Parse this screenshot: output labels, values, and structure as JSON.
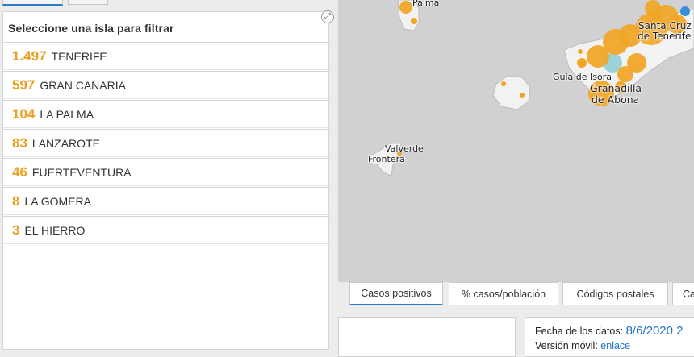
{
  "panel": {
    "title": "Seleccione una isla para filtrar",
    "expand_icon": "expand-icon",
    "islands": [
      {
        "count": "1.497",
        "name": "TENERIFE"
      },
      {
        "count": "597",
        "name": "GRAN CANARIA"
      },
      {
        "count": "104",
        "name": "LA PALMA"
      },
      {
        "count": "83",
        "name": "LANZAROTE"
      },
      {
        "count": "46",
        "name": "FUERTEVENTURA"
      },
      {
        "count": "8",
        "name": "LA GOMERA"
      },
      {
        "count": "3",
        "name": "EL HIERRO"
      }
    ]
  },
  "map": {
    "labels": {
      "palma": "Palma",
      "santa_cruz_1": "Santa Cruz",
      "santa_cruz_2": "de Tenerife",
      "guia": "Guía de Isora",
      "granadilla_1": "Granadilla",
      "granadilla_2": "de Abona",
      "valverde": "Valverde",
      "frontera": "Frontera"
    }
  },
  "tabs": [
    "Casos positivos",
    "% casos/población",
    "Códigos postales",
    "Ca"
  ],
  "info": {
    "date_label": "Fecha de los datos:",
    "date_value": "8/6/2020 2",
    "mobile_label": "Versión móvil:",
    "mobile_link": "enlace"
  },
  "colors": {
    "accent": "#e8a020",
    "link": "#1f73c8",
    "tab_active": "#2a7bc7"
  }
}
